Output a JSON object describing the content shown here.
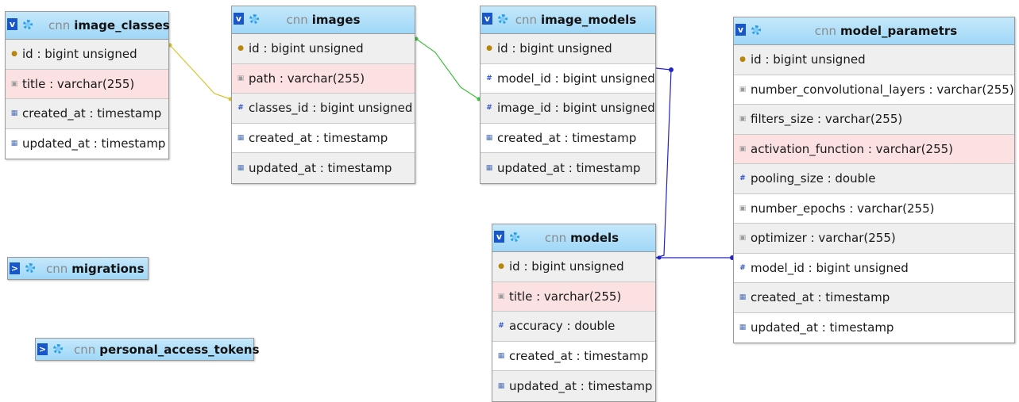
{
  "db_prefix": "cnn",
  "toggle_expanded": "v",
  "toggle_collapsed": ">",
  "tables": {
    "image_classes": {
      "name": "image_classes",
      "columns": [
        "id : bigint unsigned",
        "title : varchar(255)",
        "created_at : timestamp",
        "updated_at : timestamp"
      ]
    },
    "images": {
      "name": "images",
      "columns": [
        "id : bigint unsigned",
        "path : varchar(255)",
        "classes_id : bigint unsigned",
        "created_at : timestamp",
        "updated_at : timestamp"
      ]
    },
    "image_models": {
      "name": "image_models",
      "columns": [
        "id : bigint unsigned",
        "model_id : bigint unsigned",
        "image_id : bigint unsigned",
        "created_at : timestamp",
        "updated_at : timestamp"
      ]
    },
    "models": {
      "name": "models",
      "columns": [
        "id : bigint unsigned",
        "title : varchar(255)",
        "accuracy : double",
        "created_at : timestamp",
        "updated_at : timestamp"
      ]
    },
    "model_parametrs": {
      "name": "model_parametrs",
      "columns": [
        "id : bigint unsigned",
        "number_convolutional_layers : varchar(255)",
        "filters_size : varchar(255)",
        "activation_function : varchar(255)",
        "pooling_size : double",
        "number_epochs : varchar(255)",
        "optimizer : varchar(255)",
        "model_id : bigint unsigned",
        "created_at : timestamp",
        "updated_at : timestamp"
      ]
    },
    "migrations": {
      "name": "migrations"
    },
    "personal_access_tokens": {
      "name": "personal_access_tokens"
    }
  },
  "relation_colors": {
    "classes_link": "#d6c430",
    "images_link": "#3fbf3f",
    "models_link": "#2323c8"
  }
}
